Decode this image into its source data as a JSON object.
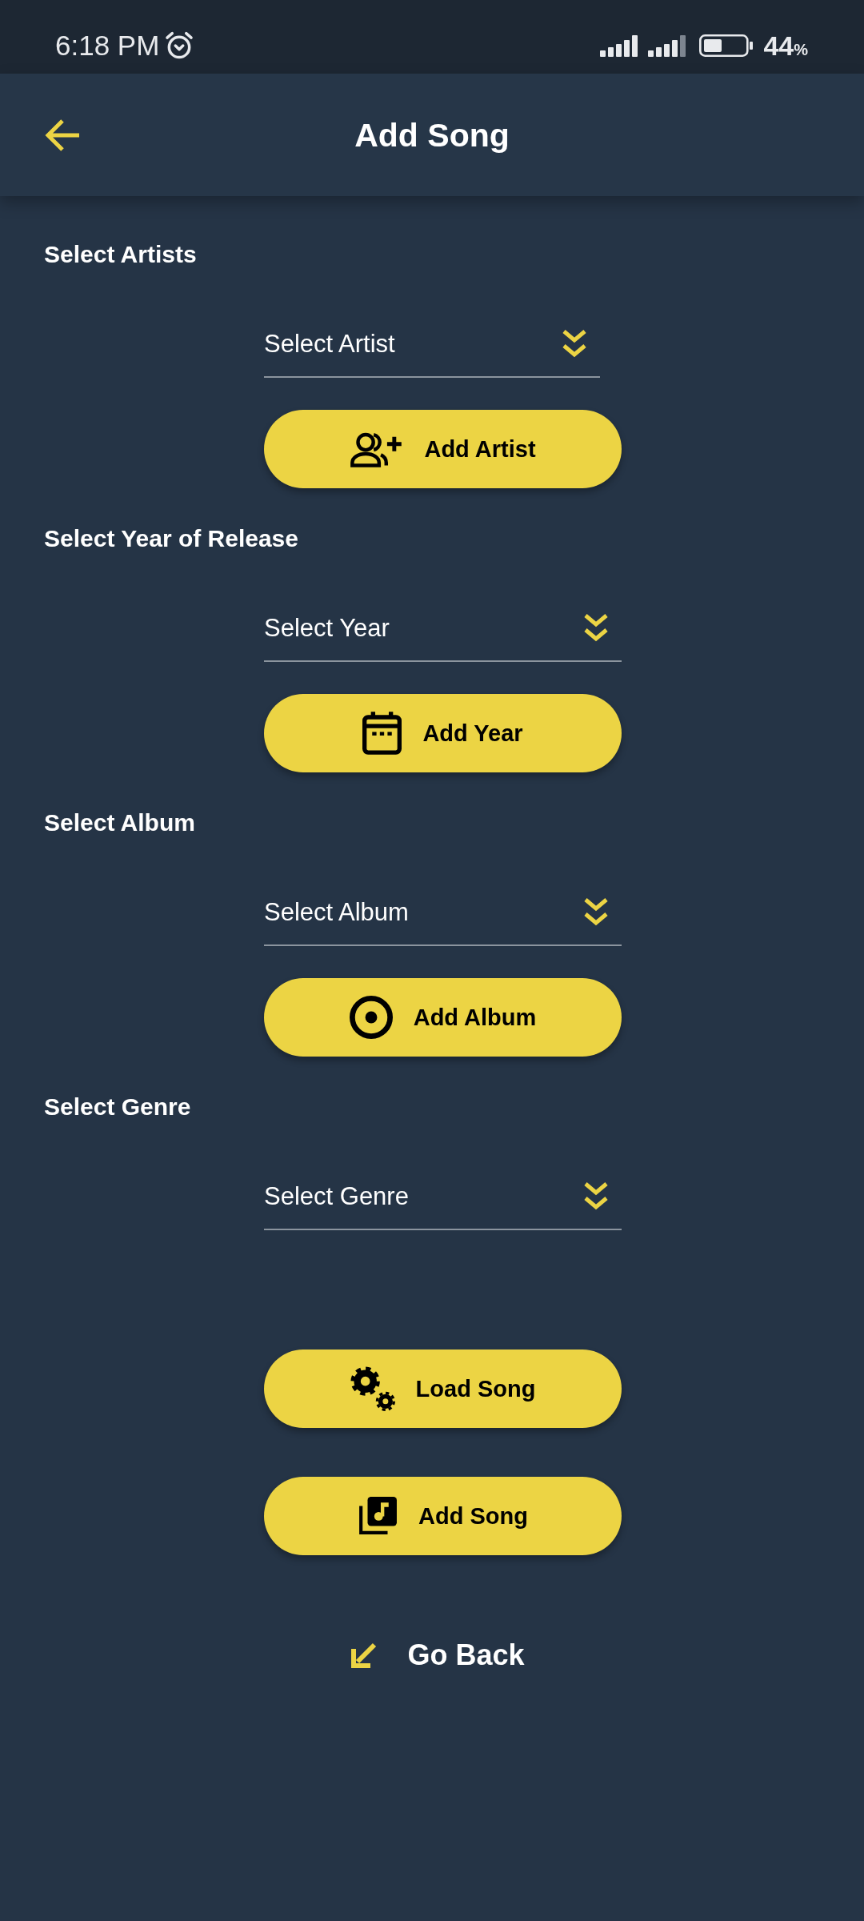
{
  "status_bar": {
    "time": "6:18 PM",
    "battery": "44",
    "battery_unit": "%"
  },
  "app_bar": {
    "title": "Add Song"
  },
  "sections": [
    {
      "label": "Select Artists",
      "dropdown": {
        "placeholder": "Select Artist"
      },
      "button": {
        "kind": "artist",
        "label": "Add Artist"
      }
    },
    {
      "label": "Select Year of Release",
      "dropdown": {
        "placeholder": "Select Year"
      },
      "button": {
        "kind": "year",
        "label": "Add Year"
      }
    },
    {
      "label": "Select Album",
      "dropdown": {
        "placeholder": "Select Album"
      },
      "button": {
        "kind": "album",
        "label": "Add Album"
      }
    },
    {
      "label": "Select Genre",
      "dropdown": {
        "placeholder": "Select Genre"
      }
    }
  ],
  "actions": [
    {
      "kind": "load",
      "label": "Load Song"
    },
    {
      "kind": "song",
      "label": "Add Song"
    }
  ],
  "go_back": {
    "label": "Go Back"
  }
}
